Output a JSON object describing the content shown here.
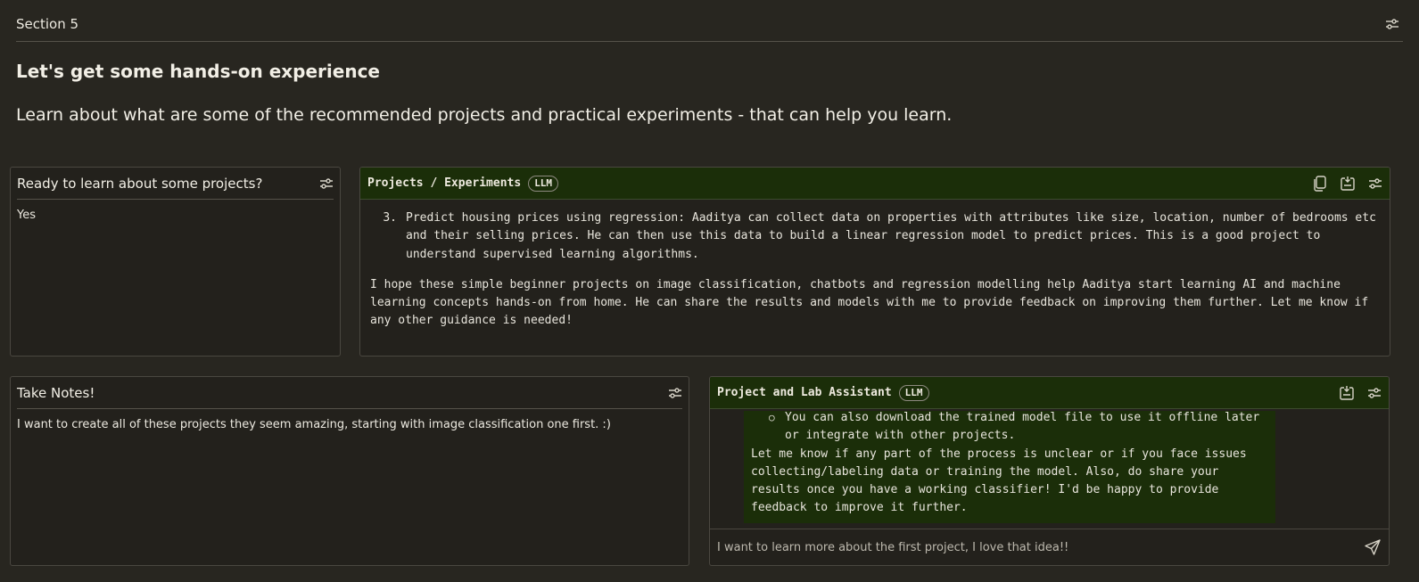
{
  "section": {
    "title": "Section 5",
    "heading": "Let's get some hands-on experience",
    "subheading": "Learn about what are some of the recommended projects and practical experiments - that can help you learn."
  },
  "ready_panel": {
    "title": "Ready to learn about some projects?",
    "value": "Yes"
  },
  "projects_panel": {
    "title": "Projects / Experiments",
    "badge": "LLM",
    "list_items": [
      {
        "number": "3.",
        "text": "Predict housing prices using regression: Aaditya can collect data on properties with attributes like size, location, number of bedrooms etc and their selling prices. He can then use this data to build a linear regression model to predict prices. This is a good project to understand supervised learning algorithms."
      }
    ],
    "paragraph": "I hope these simple beginner projects on image classification, chatbots and regression modelling help Aaditya start learning AI and machine learning concepts hands-on from home. He can share the results and models with me to provide feedback on improving them further. Let me know if any other guidance is needed!"
  },
  "notes_panel": {
    "title": "Take Notes!",
    "value": "I want to create all of these projects they seem amazing, starting with image classification one first. :)"
  },
  "assistant_panel": {
    "title": "Project and Lab Assistant",
    "badge": "LLM",
    "bullet": "You can also download the trained model file to use it offline later or integrate with other projects.",
    "message": "Let me know if any part of the process is unclear or if you face issues collecting/labeling data or training the model. Also, do share your results once you have a working classifier! I'd be happy to provide feedback to improve it further.",
    "input_placeholder": "I want to learn more about the first project, I love that idea!!"
  },
  "icons": {
    "settings": "sliders-icon",
    "copy": "copy-icon",
    "export": "export-icon",
    "send": "send-icon"
  }
}
